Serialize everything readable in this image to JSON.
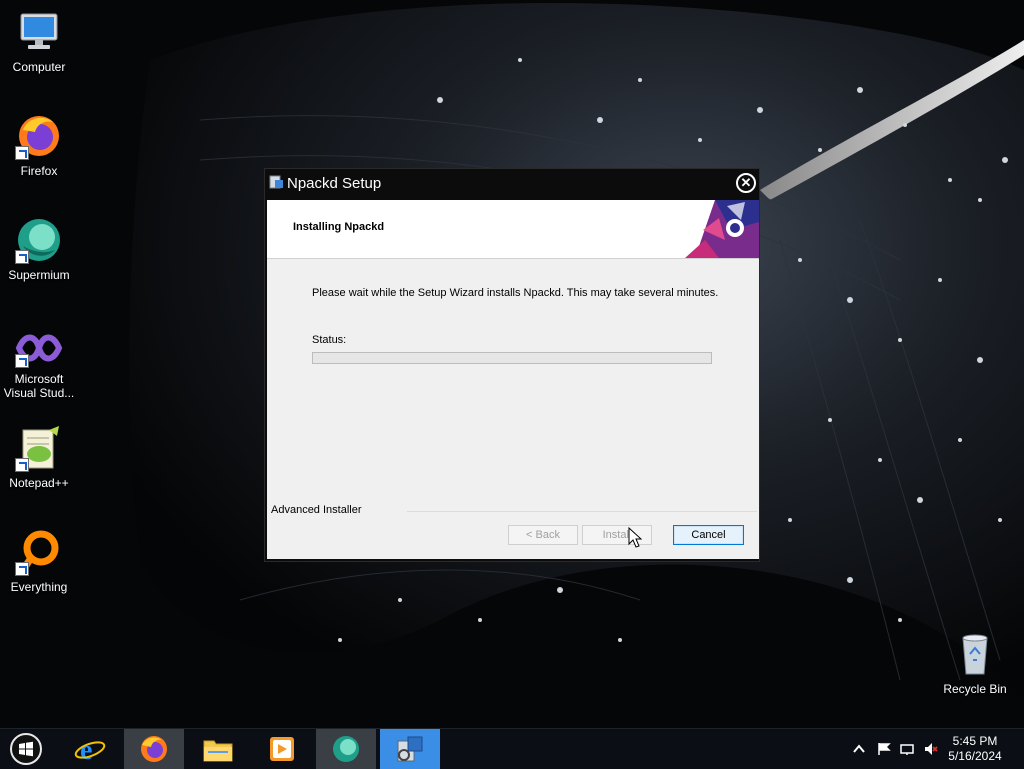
{
  "desktop": {
    "icons": [
      {
        "label": "Computer",
        "icon": "computer-icon"
      },
      {
        "label": "Firefox",
        "icon": "firefox-icon"
      },
      {
        "label": "Supermium",
        "icon": "supermium-icon"
      },
      {
        "label": "Microsoft Visual Stud...",
        "icon": "visual-studio-icon"
      },
      {
        "label": "Notepad++",
        "icon": "notepadpp-icon"
      },
      {
        "label": "Everything",
        "icon": "everything-icon"
      }
    ],
    "recycle_bin": {
      "label": "Recycle Bin",
      "icon": "recycle-bin-icon"
    }
  },
  "dialog": {
    "title": "Npackd Setup",
    "header_title": "Installing Npackd",
    "message": "Please wait while the Setup Wizard installs Npackd.  This may take several minutes.",
    "status_label": "Status:",
    "progress_fraction": 0,
    "brand": "Advanced Installer",
    "buttons": {
      "back": "< Back",
      "install": "Install",
      "cancel": "Cancel"
    }
  },
  "taskbar": {
    "apps": [
      {
        "name": "internet-explorer",
        "icon": "ie-icon"
      },
      {
        "name": "firefox",
        "icon": "firefox-icon"
      },
      {
        "name": "file-explorer",
        "icon": "folder-icon"
      },
      {
        "name": "media-player",
        "icon": "media-player-icon"
      },
      {
        "name": "supermium",
        "icon": "supermium-icon"
      },
      {
        "name": "setup",
        "icon": "installer-icon"
      }
    ],
    "clock": {
      "time": "5:45 PM",
      "date": "5/16/2024"
    }
  },
  "colors": {
    "progress_green": "#06b025",
    "taskbar_selected": "#3a8ee6",
    "dialog_frame": "#0c0c0c"
  }
}
